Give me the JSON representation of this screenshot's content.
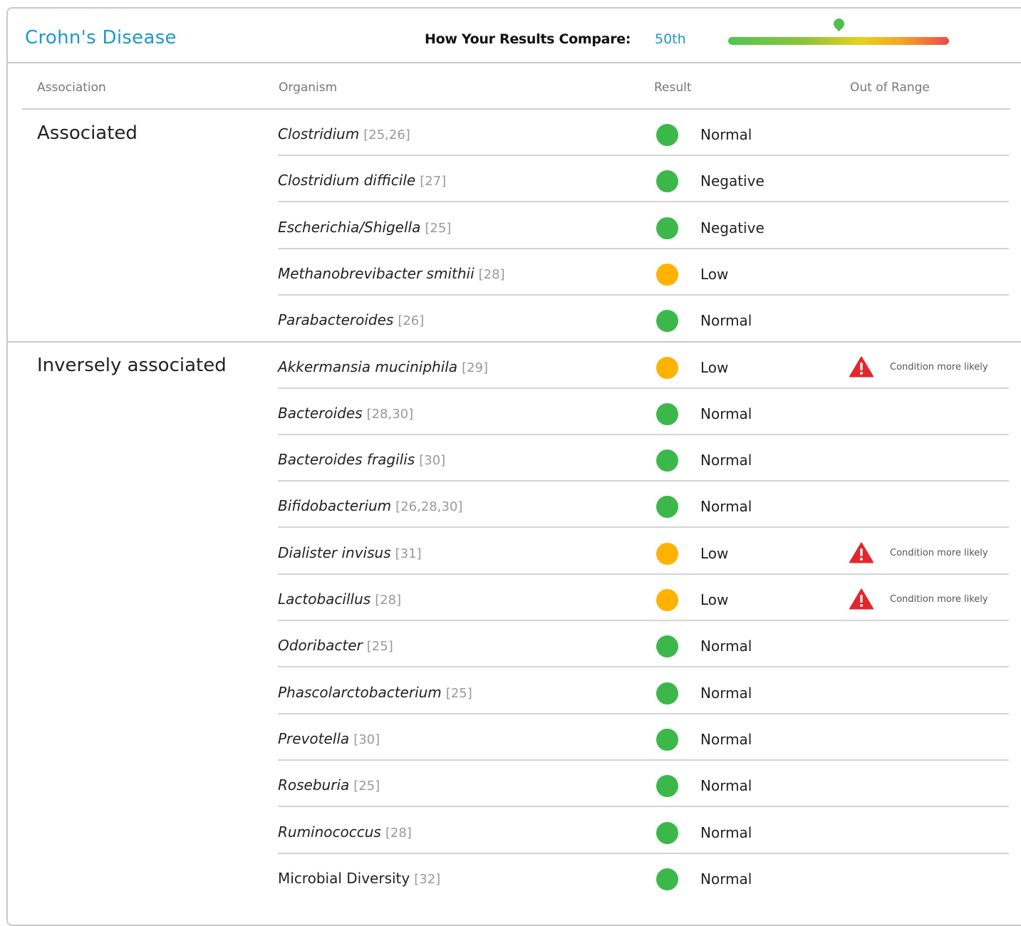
{
  "header": {
    "title": "Crohn's Disease",
    "compare_label": "How Your Results Compare:",
    "compare_value": "50th",
    "percentile_fraction": 0.5
  },
  "columns": {
    "association": "Association",
    "organism": "Organism",
    "result": "Result",
    "out_of_range": "Out of Range"
  },
  "colors": {
    "normal": "#3cb84a",
    "low": "#ffb200",
    "warning": "#e3262b",
    "accent": "#1a9ac9"
  },
  "groups": [
    {
      "label": "Associated",
      "rows": [
        {
          "organism": "Clostridium",
          "ref": "[25,26]",
          "result": "Normal",
          "status": "normal",
          "italic": true,
          "warning": ""
        },
        {
          "organism": "Clostridium difficile",
          "ref": "[27]",
          "result": "Negative",
          "status": "normal",
          "italic": true,
          "warning": ""
        },
        {
          "organism": "Escherichia/Shigella",
          "ref": "[25]",
          "result": "Negative",
          "status": "normal",
          "italic": true,
          "warning": ""
        },
        {
          "organism": "Methanobrevibacter smithii",
          "ref": "[28]",
          "result": "Low",
          "status": "low",
          "italic": true,
          "warning": ""
        },
        {
          "organism": "Parabacteroides",
          "ref": "[26]",
          "result": "Normal",
          "status": "normal",
          "italic": true,
          "warning": ""
        }
      ]
    },
    {
      "label": "Inversely associated",
      "rows": [
        {
          "organism": "Akkermansia muciniphila",
          "ref": "[29]",
          "result": "Low",
          "status": "low",
          "italic": true,
          "warning": "Condition more likely"
        },
        {
          "organism": "Bacteroides",
          "ref": "[28,30]",
          "result": "Normal",
          "status": "normal",
          "italic": true,
          "warning": ""
        },
        {
          "organism": "Bacteroides fragilis",
          "ref": "[30]",
          "result": "Normal",
          "status": "normal",
          "italic": true,
          "warning": ""
        },
        {
          "organism": "Bifidobacterium",
          "ref": "[26,28,30]",
          "result": "Normal",
          "status": "normal",
          "italic": true,
          "warning": ""
        },
        {
          "organism": "Dialister invisus",
          "ref": "[31]",
          "result": "Low",
          "status": "low",
          "italic": true,
          "warning": "Condition more likely"
        },
        {
          "organism": "Lactobacillus",
          "ref": "[28]",
          "result": "Low",
          "status": "low",
          "italic": true,
          "warning": "Condition more likely"
        },
        {
          "organism": "Odoribacter",
          "ref": "[25]",
          "result": "Normal",
          "status": "normal",
          "italic": true,
          "warning": ""
        },
        {
          "organism": "Phascolarctobacterium",
          "ref": "[25]",
          "result": "Normal",
          "status": "normal",
          "italic": true,
          "warning": ""
        },
        {
          "organism": "Prevotella",
          "ref": "[30]",
          "result": "Normal",
          "status": "normal",
          "italic": true,
          "warning": ""
        },
        {
          "organism": "Roseburia",
          "ref": "[25]",
          "result": "Normal",
          "status": "normal",
          "italic": true,
          "warning": ""
        },
        {
          "organism": "Ruminococcus",
          "ref": "[28]",
          "result": "Normal",
          "status": "normal",
          "italic": true,
          "warning": ""
        },
        {
          "organism": "Microbial Diversity",
          "ref": "[32]",
          "result": "Normal",
          "status": "normal",
          "italic": false,
          "warning": ""
        }
      ]
    }
  ]
}
